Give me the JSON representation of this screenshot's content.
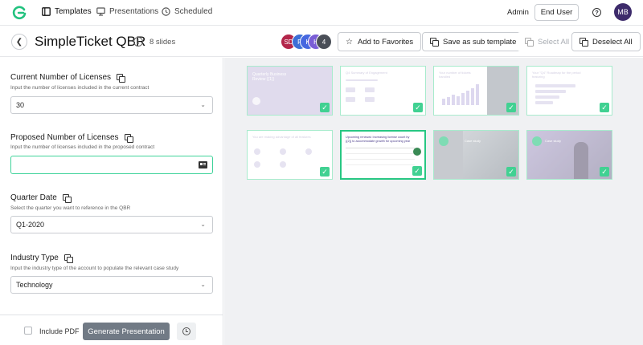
{
  "nav": {
    "tabs": [
      {
        "label": "Templates",
        "icon": "templates-icon"
      },
      {
        "label": "Presentations",
        "icon": "presentation-icon"
      },
      {
        "label": "Scheduled",
        "icon": "clock-icon"
      }
    ],
    "admin_label": "Admin",
    "end_user_label": "End User",
    "help_glyph": "?",
    "user_initials": "MB"
  },
  "header": {
    "title": "SimpleTicket QBR",
    "info_glyph": "i",
    "slide_count": "8 slides",
    "collaborators": [
      {
        "initials": "SD",
        "color": "#b3264a"
      },
      {
        "initials": "R",
        "color": "#3d6fd6"
      },
      {
        "initials": "K",
        "color": "#4567e0"
      },
      {
        "initials": "H",
        "color": "#7a5ed6"
      },
      {
        "initials": "4",
        "color": "#4a4f58"
      }
    ],
    "add_favorites": "Add to Favorites",
    "save_sub": "Save as sub template",
    "select_all": "Select All",
    "deselect_all": "Deselect All"
  },
  "form": {
    "fields": [
      {
        "label": "Current Number of Licenses",
        "hint": "Input the number of licenses included in the current contract",
        "value": "30",
        "type": "select"
      },
      {
        "label": "Proposed Number of Licenses",
        "hint": "Input the number of licenses included in the proposed contract",
        "value": "",
        "type": "input"
      },
      {
        "label": "Quarter Date",
        "hint": "Select the quarter you want to reference in the QBR",
        "value": "Q1-2020",
        "type": "select"
      },
      {
        "label": "Industry Type",
        "hint": "Input the industry type of the account to populate the relevant case study",
        "value": "Technology",
        "type": "select"
      }
    ],
    "include_pdf": "Include PDF",
    "generate": "Generate Presentation"
  },
  "slides": [
    {
      "title": "Quarterly Business Review {{1}}",
      "selected": false
    },
    {
      "title": "Q4 Summary of Engagement",
      "selected": false
    },
    {
      "title": "Your number of tickets handled",
      "selected": false
    },
    {
      "title": "Your \"Q4\" Roadmap for the period featuring",
      "selected": false
    },
    {
      "title": "You are making advantage of all features",
      "selected": false
    },
    {
      "title": "Upcoming renewal: Increasing license count by {{2}} to accommodate growth for upcoming year",
      "selected": true
    },
    {
      "title": "Case study",
      "selected": false
    },
    {
      "title": "Case study",
      "selected": false
    }
  ],
  "colors": {
    "accent": "#28c783",
    "check_bg": "#41d192",
    "selected_border": "#3fd39a"
  }
}
